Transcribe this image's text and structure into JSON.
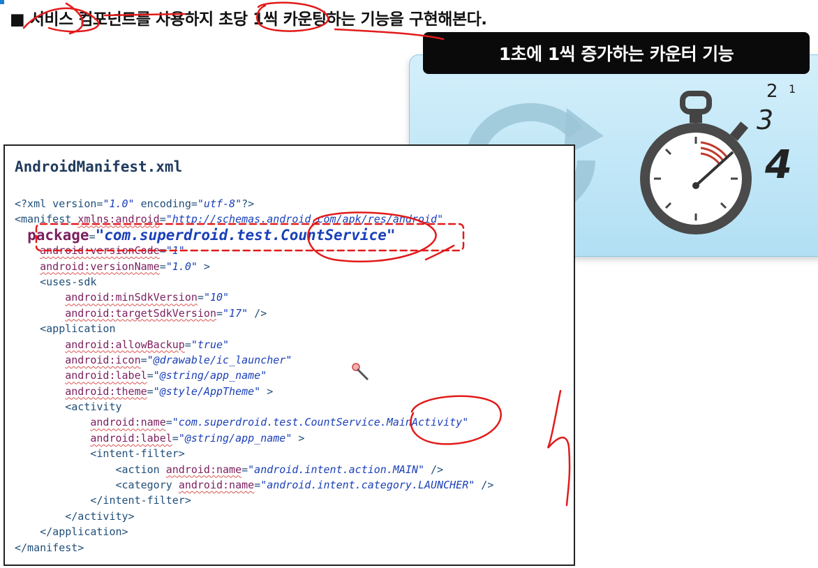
{
  "slide": {
    "title": "■ 서비스 컴포넌트를 사용하지 초당 1씩 카운팅하는 기능을 구현해본다."
  },
  "banner": {
    "text": "1초에 1씩 증가하는 카운터 기능"
  },
  "illustration": {
    "count_digits": [
      "1",
      "2",
      "3",
      "4"
    ],
    "icons": [
      "refresh-icon",
      "stopwatch-icon"
    ]
  },
  "code_panel": {
    "file_name": "AndroidManifest.xml",
    "lines": [
      [
        [
          "t",
          "<?xml version="
        ],
        [
          "v",
          "\"1.0\""
        ],
        [
          "t",
          " encoding="
        ],
        [
          "v",
          "\"utf-8\""
        ],
        [
          "t",
          "?>"
        ]
      ],
      [
        [
          "t",
          "<manifest "
        ],
        [
          "a",
          "xmlns:android"
        ],
        [
          "t",
          "="
        ],
        [
          "v",
          "\"http://schemas.android.com/apk/res/android\""
        ]
      ],
      [
        [
          "t",
          "  "
        ],
        [
          "ba",
          "package"
        ],
        [
          "t",
          "="
        ],
        [
          "bv",
          "\"com.superdroid.test.CountService\""
        ]
      ],
      [
        [
          "t",
          "    "
        ],
        [
          "a",
          "android:versionCode"
        ],
        [
          "t",
          "="
        ],
        [
          "v",
          "\"1\""
        ]
      ],
      [
        [
          "t",
          "    "
        ],
        [
          "a",
          "android:versionName"
        ],
        [
          "t",
          "="
        ],
        [
          "v",
          "\"1.0\""
        ],
        [
          "t",
          " >"
        ]
      ],
      [
        [
          "t",
          "    <uses-sdk"
        ]
      ],
      [
        [
          "t",
          "        "
        ],
        [
          "a",
          "android:minSdkVersion"
        ],
        [
          "t",
          "="
        ],
        [
          "v",
          "\"10\""
        ]
      ],
      [
        [
          "t",
          "        "
        ],
        [
          "a",
          "android:targetSdkVersion"
        ],
        [
          "t",
          "="
        ],
        [
          "v",
          "\"17\""
        ],
        [
          "t",
          " />"
        ]
      ],
      [
        [
          "t",
          "    <application"
        ]
      ],
      [
        [
          "t",
          "        "
        ],
        [
          "a",
          "android:allowBackup"
        ],
        [
          "t",
          "="
        ],
        [
          "v",
          "\"true\""
        ]
      ],
      [
        [
          "t",
          "        "
        ],
        [
          "a",
          "android:icon"
        ],
        [
          "t",
          "="
        ],
        [
          "v",
          "\"@drawable/ic_launcher\""
        ]
      ],
      [
        [
          "t",
          "        "
        ],
        [
          "a",
          "android:label"
        ],
        [
          "t",
          "="
        ],
        [
          "v",
          "\"@string/app_name\""
        ]
      ],
      [
        [
          "t",
          "        "
        ],
        [
          "a",
          "android:theme"
        ],
        [
          "t",
          "="
        ],
        [
          "v",
          "\"@style/AppTheme\""
        ],
        [
          "t",
          " >"
        ]
      ],
      [
        [
          "t",
          "        <activity"
        ]
      ],
      [
        [
          "t",
          "            "
        ],
        [
          "a",
          "android:name"
        ],
        [
          "t",
          "="
        ],
        [
          "v",
          "\"com.superdroid.test.CountService.MainActivity\""
        ]
      ],
      [
        [
          "t",
          "            "
        ],
        [
          "a",
          "android:label"
        ],
        [
          "t",
          "="
        ],
        [
          "v",
          "\"@string/app_name\""
        ],
        [
          "t",
          " >"
        ]
      ],
      [
        [
          "t",
          "            <intent-filter>"
        ]
      ],
      [
        [
          "t",
          "                <action "
        ],
        [
          "a",
          "android:name"
        ],
        [
          "t",
          "="
        ],
        [
          "v",
          "\"android.intent.action.MAIN\""
        ],
        [
          "t",
          " />"
        ]
      ],
      [
        [
          "t",
          "                <category "
        ],
        [
          "a",
          "android:name"
        ],
        [
          "t",
          "="
        ],
        [
          "v",
          "\"android.intent.category.LAUNCHER\""
        ],
        [
          "t",
          " />"
        ]
      ],
      [
        [
          "t",
          "            </intent-filter>"
        ]
      ],
      [
        [
          "t",
          "        </activity>"
        ]
      ],
      [
        [
          "t",
          "    </application>"
        ]
      ],
      [
        [
          "t",
          "</manifest>"
        ]
      ]
    ]
  }
}
